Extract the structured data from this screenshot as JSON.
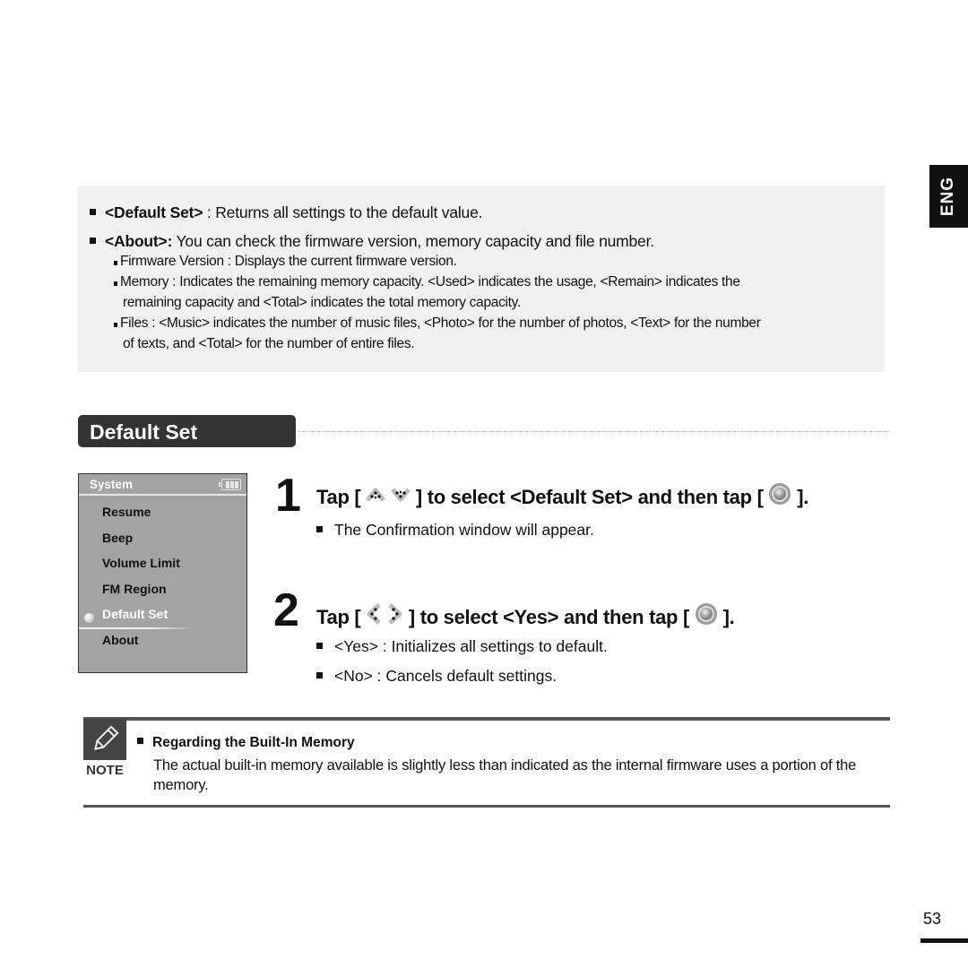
{
  "language_tab": "ENG",
  "info_box": {
    "items": [
      {
        "term": "<Default Set>",
        "text": " : Returns all settings to the default value."
      },
      {
        "term": "<About>:",
        "text": " You can check the firmware version, memory capacity and file number."
      }
    ],
    "sub_items": [
      {
        "lines": [
          "Firmware Version : Displays the current firmware version."
        ]
      },
      {
        "lines": [
          "Memory : Indicates the remaining memory capacity. <Used> indicates the usage, <Remain> indicates the",
          "remaining capacity and <Total> indicates the total memory capacity."
        ]
      },
      {
        "lines": [
          "Files : <Music> indicates the number of music files, <Photo> for the number of photos, <Text> for the number",
          "of texts, and <Total> for the number of entire files."
        ]
      }
    ]
  },
  "section_title": "Default Set",
  "device_screen": {
    "title": "System",
    "battery_icon": "battery-full-icon",
    "items": [
      "Resume",
      "Beep",
      "Volume Limit",
      "FM Region",
      "Default Set",
      "About"
    ],
    "selected": "Default Set"
  },
  "steps": [
    {
      "number": "1",
      "text_before": "Tap [",
      "icons": [
        "up-arrow-icon",
        "down-arrow-icon"
      ],
      "text_middle": "] to select <Default Set> and then tap [",
      "end_icon": "select-button-icon",
      "text_after": "].",
      "bullets": [
        "The Confirmation window will appear."
      ]
    },
    {
      "number": "2",
      "text_before": "Tap [",
      "icons": [
        "left-arrow-icon",
        "right-arrow-icon"
      ],
      "text_middle": "] to select <Yes> and then tap [",
      "end_icon": "select-button-icon",
      "text_after": "].",
      "bullets": [
        "<Yes> :  Initializes all settings to default.",
        "<No> : Cancels default settings."
      ]
    }
  ],
  "note": {
    "label": "NOTE",
    "icon": "pencil-icon",
    "heading": "Regarding the Built-In Memory",
    "body": "The actual built-in memory available is slightly less than indicated as the internal firmware uses a portion of the memory."
  },
  "page_number": "53"
}
